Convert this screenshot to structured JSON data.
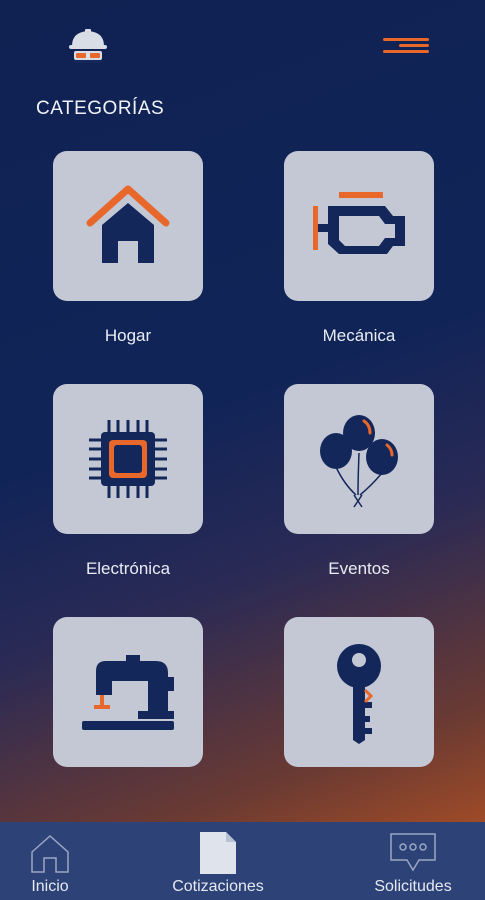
{
  "header": {
    "logo_icon": "worker-helmet-icon",
    "menu_icon": "hamburger-menu-icon",
    "accent_color": "#e8672a",
    "navy_color": "#14275a"
  },
  "section_title": "CATEGORÍAS",
  "categories": [
    {
      "label": "Hogar",
      "icon": "house-icon"
    },
    {
      "label": "Mecánica",
      "icon": "engine-icon"
    },
    {
      "label": "Electrónica",
      "icon": "chip-icon"
    },
    {
      "label": "Eventos",
      "icon": "balloons-icon"
    },
    {
      "label": "",
      "icon": "sewing-machine-icon"
    },
    {
      "label": "",
      "icon": "key-icon"
    }
  ],
  "bottom_nav": [
    {
      "label": "Inicio",
      "icon": "home-outline-icon"
    },
    {
      "label": "Cotizaciones",
      "icon": "document-icon"
    },
    {
      "label": "Solicitudes",
      "icon": "chat-bubble-icon"
    }
  ]
}
